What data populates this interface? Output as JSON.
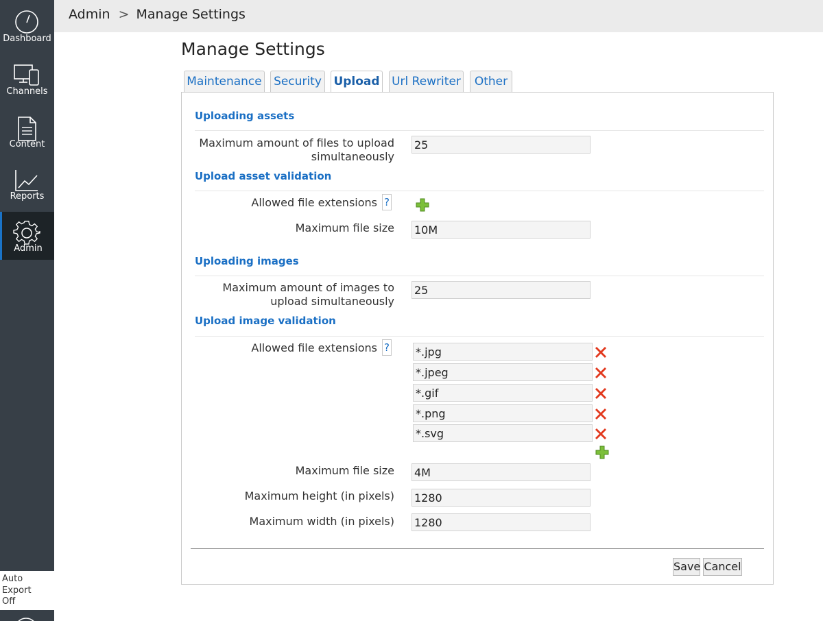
{
  "sidebar": {
    "items": [
      {
        "label": "Dashboard",
        "icon": "dashboard-icon"
      },
      {
        "label": "Channels",
        "icon": "channels-icon"
      },
      {
        "label": "Content",
        "icon": "content-icon"
      },
      {
        "label": "Reports",
        "icon": "reports-icon"
      },
      {
        "label": "Admin",
        "icon": "admin-gear-icon",
        "active": true
      }
    ],
    "auto_export": [
      "Auto",
      "Export",
      "Off"
    ]
  },
  "breadcrumb": {
    "root": "Admin",
    "separator": ">",
    "current": "Manage Settings"
  },
  "page": {
    "title": "Manage Settings"
  },
  "tabs": [
    {
      "label": "Maintenance"
    },
    {
      "label": "Security"
    },
    {
      "label": "Upload",
      "active": true
    },
    {
      "label": "Url Rewriter"
    },
    {
      "label": "Other"
    }
  ],
  "upload": {
    "uploading_assets": {
      "heading": "Uploading assets",
      "max_files_label_line1": "Maximum amount of files to upload",
      "max_files_label_line2": "simultaneously",
      "max_files_value": "25"
    },
    "asset_validation": {
      "heading": "Upload asset validation",
      "allowed_ext_label": "Allowed file extensions",
      "help": "?",
      "max_size_label": "Maximum file size",
      "max_size_value": "10M"
    },
    "uploading_images": {
      "heading": "Uploading images",
      "max_images_label_line1": "Maximum amount of images to",
      "max_images_label_line2": "upload simultaneously",
      "max_images_value": "25"
    },
    "image_validation": {
      "heading": "Upload image validation",
      "allowed_ext_label": "Allowed file extensions",
      "help": "?",
      "extensions": [
        "*.jpg",
        "*.jpeg",
        "*.gif",
        "*.png",
        "*.svg"
      ],
      "max_size_label": "Maximum file size",
      "max_size_value": "4M",
      "max_height_label": "Maximum height (in pixels)",
      "max_height_value": "1280",
      "max_width_label": "Maximum width (in pixels)",
      "max_width_value": "1280"
    }
  },
  "actions": {
    "save": "Save",
    "cancel": "Cancel"
  },
  "colors": {
    "sidebar": "#373f47",
    "accent": "#1a6fc4",
    "delete": "#e2381d",
    "add": "#7cbf3a"
  }
}
